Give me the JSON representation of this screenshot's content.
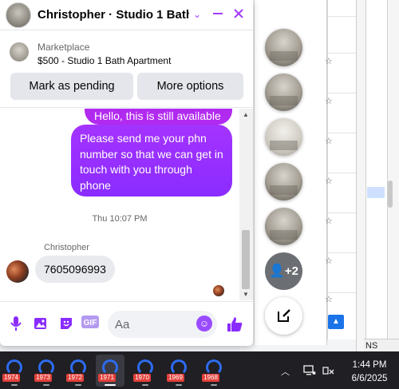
{
  "header": {
    "title": "Christopher · Studio 1 Bath…",
    "icons": [
      "chevron-down-icon",
      "minimize-icon",
      "close-icon"
    ]
  },
  "listing": {
    "label": "Marketplace",
    "title": "$500 - Studio 1 Bath Apartment",
    "mark_pending_label": "Mark as pending",
    "more_options_label": "More options"
  },
  "messages": {
    "outgoing_partial": "Hello, this is still available",
    "outgoing_main": "Please send me your phn number so that we can get in touch with you through phone",
    "timestamp": "Thu 10:07 PM",
    "sender_name": "Christopher",
    "incoming": "7605096993"
  },
  "composer": {
    "placeholder": "Aa",
    "icons": [
      "microphone-icon",
      "photo-icon",
      "sticker-icon",
      "gif-icon",
      "emoji-icon",
      "like-icon"
    ]
  },
  "chat_heads": {
    "more_label": "+2"
  },
  "background": {
    "ns_label": "NS"
  },
  "taskbar": {
    "apps": [
      "1974",
      "1973",
      "1972",
      "1971",
      "1970",
      "1969",
      "1968"
    ],
    "active_app": "1971",
    "time": "1:44 PM",
    "date": "6/6/2025"
  },
  "colors": {
    "accent": "#8a2cff",
    "bubble_in": "#e9eaee",
    "taskbar": "#1f1f24"
  }
}
